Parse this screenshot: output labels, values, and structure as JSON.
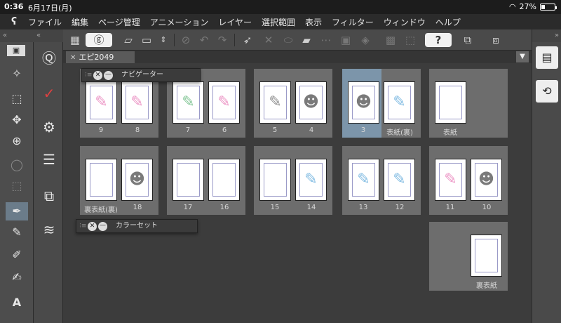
{
  "status": {
    "time": "0:36",
    "date": "6月17日(月)",
    "battery": "27%",
    "battery_level": 0.27
  },
  "menu": {
    "logo": "ʕ",
    "items": [
      "ファイル",
      "編集",
      "ページ管理",
      "アニメーション",
      "レイヤー",
      "選択範囲",
      "表示",
      "フィルター",
      "ウィンドウ",
      "ヘルプ"
    ]
  },
  "toolbar": {
    "icons": [
      "grid-icon",
      "cloud-service-icon",
      "open-folder-icon",
      "save-icon",
      "up-down-icon",
      "clear-icon",
      "undo-icon",
      "redo-icon",
      "select-arrow-icon",
      "transform-icon",
      "ellipse-icon",
      "eraser-icon",
      "fill-icon",
      "help-icon",
      "pages-icon",
      "pages-swap-icon"
    ],
    "help_label": "?"
  },
  "document": {
    "tab_title": "エピ2049",
    "tab_close": "✕",
    "dropdown": "▼"
  },
  "panels": {
    "navigator": "ナビゲーター",
    "color_set": "カラーセット"
  },
  "pages": {
    "row1": [
      {
        "labels": [
          "9",
          "8"
        ]
      },
      {
        "labels": [
          "7",
          "6"
        ]
      },
      {
        "labels": [
          "5",
          "4"
        ]
      },
      {
        "labels": [
          "3",
          "表紙(裏)"
        ]
      },
      {
        "labels": [
          "表紙"
        ]
      }
    ],
    "row2": [
      {
        "labels": [
          "裏表紙(裏)",
          "18"
        ]
      },
      {
        "labels": [
          "17",
          "16"
        ]
      },
      {
        "labels": [
          "15",
          "14"
        ]
      },
      {
        "labels": [
          "13",
          "12"
        ]
      },
      {
        "labels": [
          "11",
          "10"
        ]
      }
    ],
    "row3": [
      {
        "labels": [
          "裏表紙"
        ]
      }
    ]
  },
  "left_tools": [
    "wand-icon",
    "move-icon",
    "hand-icon",
    "zoom-icon",
    "lasso-icon",
    "rect-select-icon",
    "pen-icon",
    "brush-icon",
    "pencil-icon",
    "airbrush-icon",
    "text-icon"
  ],
  "left_tools2": [
    "navigator-icon",
    "pen-pressure-icon",
    "tool-settings-icon",
    "sub-tool-icon",
    "material-icon",
    "layers-icon"
  ],
  "right_dock": [
    "animation-icon",
    "sync-icon"
  ]
}
